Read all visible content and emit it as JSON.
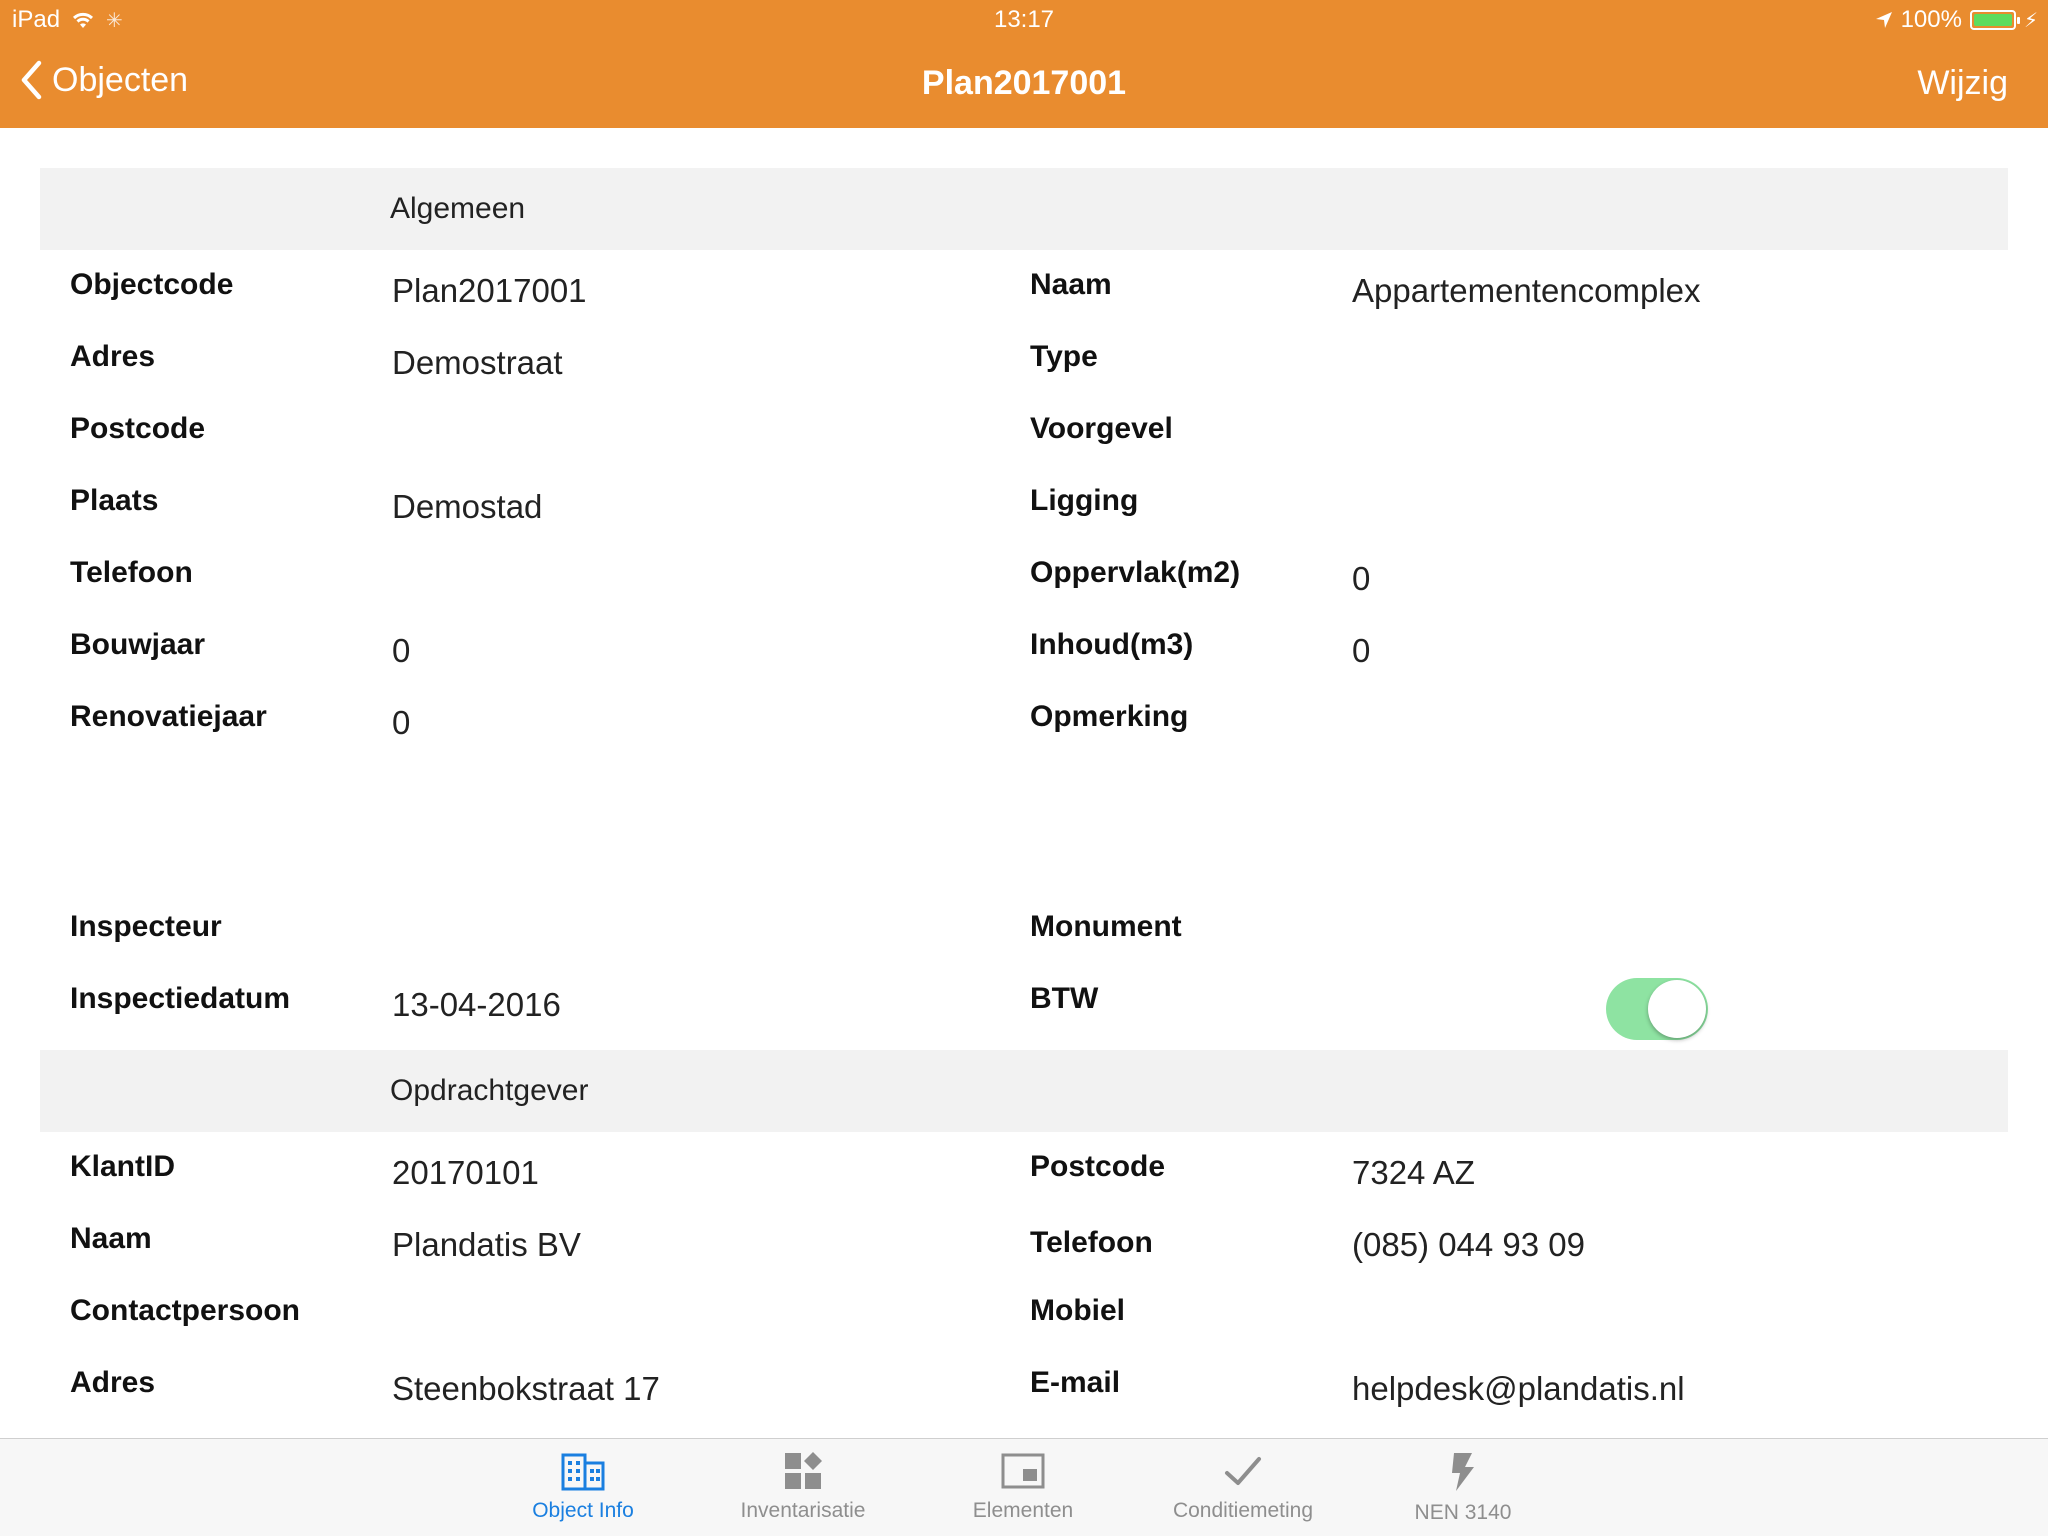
{
  "status_bar": {
    "device": "iPad",
    "time": "13:17",
    "battery": "100%"
  },
  "nav": {
    "back_label": "Objecten",
    "title": "Plan2017001",
    "edit_label": "Wijzig"
  },
  "sections": {
    "algemeen": "Algemeen",
    "opdrachtgever": "Opdrachtgever"
  },
  "algemeen": {
    "left": [
      {
        "label": "Objectcode",
        "value": "Plan2017001"
      },
      {
        "label": "Adres",
        "value": "Demostraat"
      },
      {
        "label": "Postcode",
        "value": ""
      },
      {
        "label": "Plaats",
        "value": "Demostad"
      },
      {
        "label": "Telefoon",
        "value": ""
      },
      {
        "label": "Bouwjaar",
        "value": "0"
      },
      {
        "label": "Renovatiejaar",
        "value": "0"
      },
      {
        "label": "Inspecteur",
        "value": ""
      },
      {
        "label": "Inspectiedatum",
        "value": "13-04-2016"
      }
    ],
    "right": [
      {
        "label": "Naam",
        "value": "Appartementencomplex"
      },
      {
        "label": "Type",
        "value": ""
      },
      {
        "label": "Voorgevel",
        "value": ""
      },
      {
        "label": "Ligging",
        "value": ""
      },
      {
        "label": "Oppervlak(m2)",
        "value": "0"
      },
      {
        "label": "Inhoud(m3)",
        "value": "0"
      },
      {
        "label": "Opmerking",
        "value": ""
      },
      {
        "label": "Monument",
        "value": ""
      },
      {
        "label": "BTW",
        "value": ""
      }
    ],
    "btw_toggle_on": true
  },
  "opdrachtgever": {
    "left": [
      {
        "label": "KlantID",
        "value": "20170101"
      },
      {
        "label": "Naam",
        "value": "Plandatis BV"
      },
      {
        "label": "Contactpersoon",
        "value": ""
      },
      {
        "label": "Adres",
        "value": "Steenbokstraat 17"
      }
    ],
    "right": [
      {
        "label": "Postcode",
        "value": "7324 AZ"
      },
      {
        "label": "Telefoon",
        "value": "(085) 044 93 09"
      },
      {
        "label": "Mobiel",
        "value": ""
      },
      {
        "label": "E-mail",
        "value": "helpdesk@plandatis.nl"
      }
    ]
  },
  "tabs": [
    {
      "label": "Object Info",
      "icon": "building-icon",
      "active": true
    },
    {
      "label": "Inventarisatie",
      "icon": "grid-icon",
      "active": false
    },
    {
      "label": "Elementen",
      "icon": "square-icon",
      "active": false
    },
    {
      "label": "Conditiemeting",
      "icon": "checkmark-icon",
      "active": false
    },
    {
      "label": "NEN 3140",
      "icon": "lightning-icon",
      "active": false
    }
  ],
  "colors": {
    "accent": "#e98c2f",
    "tab_active": "#1a7fe0",
    "toggle_on": "#8ee3a2"
  }
}
